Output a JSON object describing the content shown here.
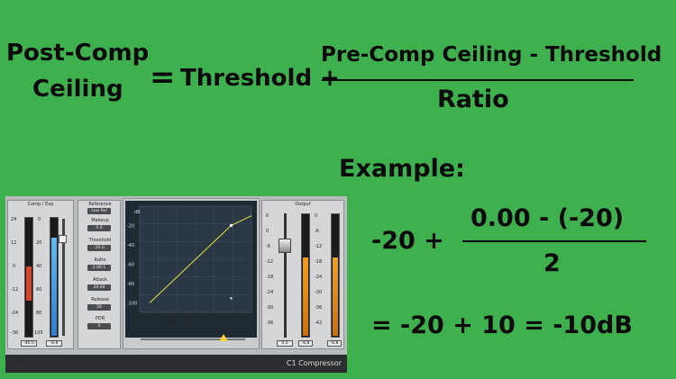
{
  "formula": {
    "lhs_line1": "Post-Comp",
    "lhs_line2": "Ceiling",
    "equals": "=",
    "term1": "Threshold +",
    "numerator": "Pre-Comp Ceiling - Threshold",
    "denominator": "Ratio"
  },
  "example": {
    "heading": "Example:",
    "term1": "-20 +",
    "numerator": "0.00 - (-20)",
    "denominator": "2",
    "result": "= -20 + 10 = -10dB"
  },
  "plugin": {
    "name": "C1 Compressor",
    "comp_exp": {
      "label": "Comp / Exp",
      "scale_left": [
        "24",
        "12",
        "0",
        "-12",
        "-24",
        "-36"
      ],
      "scale_right": [
        "0",
        "20",
        "40",
        "60",
        "80",
        "100"
      ],
      "value_left": "-40.0",
      "value_right": "-6.8"
    },
    "controls": {
      "reference_label": "Reference",
      "reference_value": "Low Ref",
      "makeup_label": "Makeup",
      "makeup_value": "0.0",
      "threshold_label": "Threshold",
      "threshold_value": "-20.0",
      "ratio_label": "Ratio",
      "ratio_value": "2.00:1",
      "attack_label": "Attack",
      "attack_value": "20.00",
      "release_label": "Release",
      "release_value": "50",
      "pdr_label": "PDR",
      "pdr_value": "0"
    },
    "graph": {
      "unit": "dB",
      "y_ticks": [
        "-20",
        "-40",
        "-60",
        "-80",
        "-100"
      ],
      "x_ticks": [
        "-100",
        "-80",
        "-60",
        "-40",
        "-20",
        "0"
      ],
      "curve_color": "#e7e23a"
    },
    "output": {
      "label": "Output",
      "fader_scale": [
        "6",
        "0",
        "-6",
        "-12",
        "-18",
        "-24",
        "-30",
        "-36"
      ],
      "meter_scale": [
        "0",
        "-6",
        "-12",
        "-18",
        "-24",
        "-30",
        "-36",
        "-42"
      ],
      "value_fader": "0.0",
      "value_left": "-6.8",
      "value_right": "-6.8"
    }
  }
}
